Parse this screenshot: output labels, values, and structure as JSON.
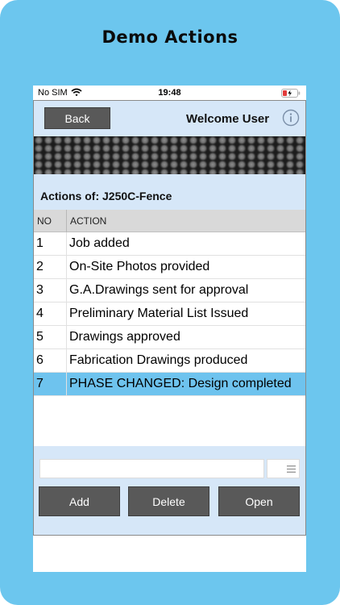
{
  "promo_title": "Demo Actions",
  "status": {
    "carrier": "No SIM",
    "time": "19:48"
  },
  "nav": {
    "back_label": "Back",
    "welcome": "Welcome User"
  },
  "section": {
    "label": "Actions of: J250C-Fence"
  },
  "table": {
    "headers": {
      "no": "NO",
      "action": "ACTION"
    },
    "rows": [
      {
        "no": "1",
        "action": "Job added"
      },
      {
        "no": "2",
        "action": "On-Site Photos provided"
      },
      {
        "no": "3",
        "action": "G.A.Drawings sent for approval"
      },
      {
        "no": "4",
        "action": "Preliminary Material List Issued"
      },
      {
        "no": "5",
        "action": "Drawings approved"
      },
      {
        "no": "6",
        "action": "Fabrication Drawings produced"
      },
      {
        "no": "7",
        "action": "PHASE CHANGED: Design completed"
      }
    ],
    "selected_row": "7"
  },
  "input": {
    "value": "",
    "placeholder": ""
  },
  "buttons": {
    "add": "Add",
    "delete": "Delete",
    "open": "Open"
  },
  "icons": {
    "wifi": "wifi-icon",
    "battery": "battery-charging-icon",
    "info": "info-icon",
    "list": "list-icon"
  },
  "colors": {
    "background": "#6cc6ee",
    "panel": "#d6e7f8",
    "button": "#595959",
    "selection": "#6ec3ee"
  }
}
